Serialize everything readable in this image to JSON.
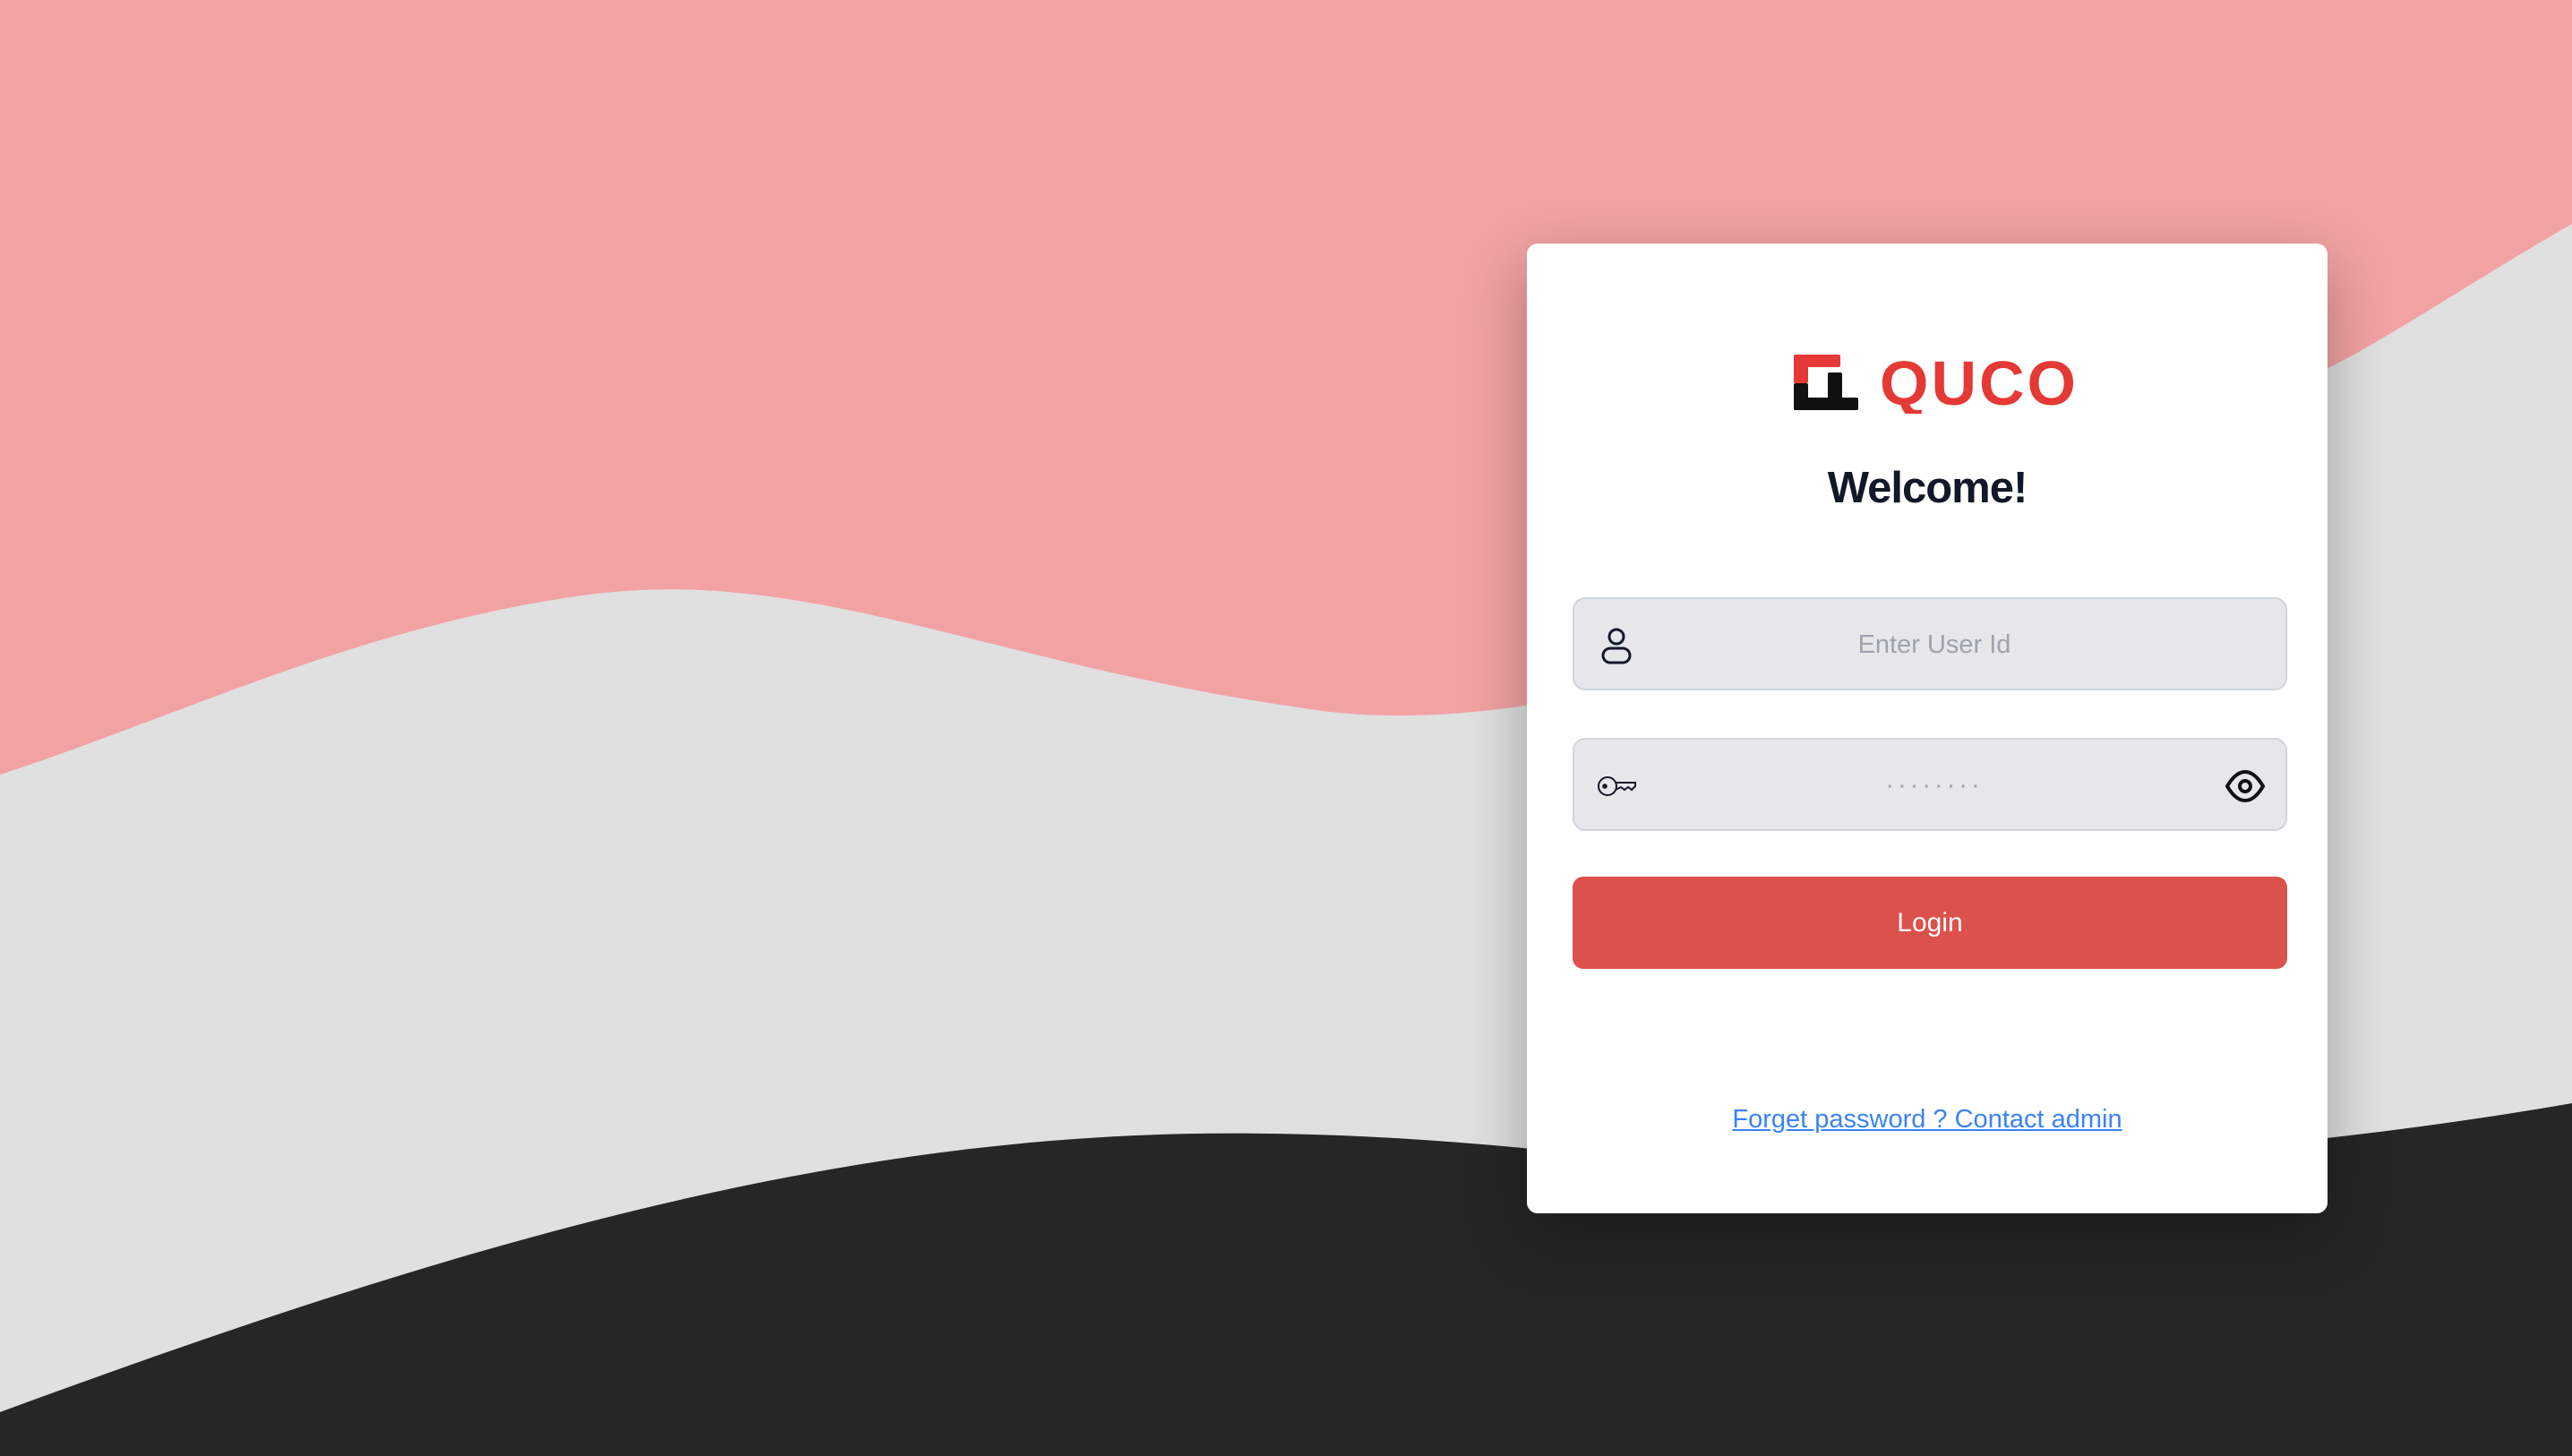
{
  "brand": {
    "name": "QUCO",
    "color": "#e53935"
  },
  "welcome": "Welcome!",
  "user_field": {
    "placeholder": "Enter User Id",
    "value": "",
    "icon": "user-icon"
  },
  "password_field": {
    "placeholder": "········",
    "value": "",
    "icon": "key-icon",
    "toggle_icon": "eye-icon"
  },
  "login_button": {
    "label": "Login",
    "color": "#dc514c"
  },
  "forgot_link": "Forget password ? Contact admin",
  "colors": {
    "wave_top": "#f3a2a3",
    "wave_middle": "#e0e0e1",
    "wave_bottom": "#262626",
    "link": "#3b82f6"
  }
}
